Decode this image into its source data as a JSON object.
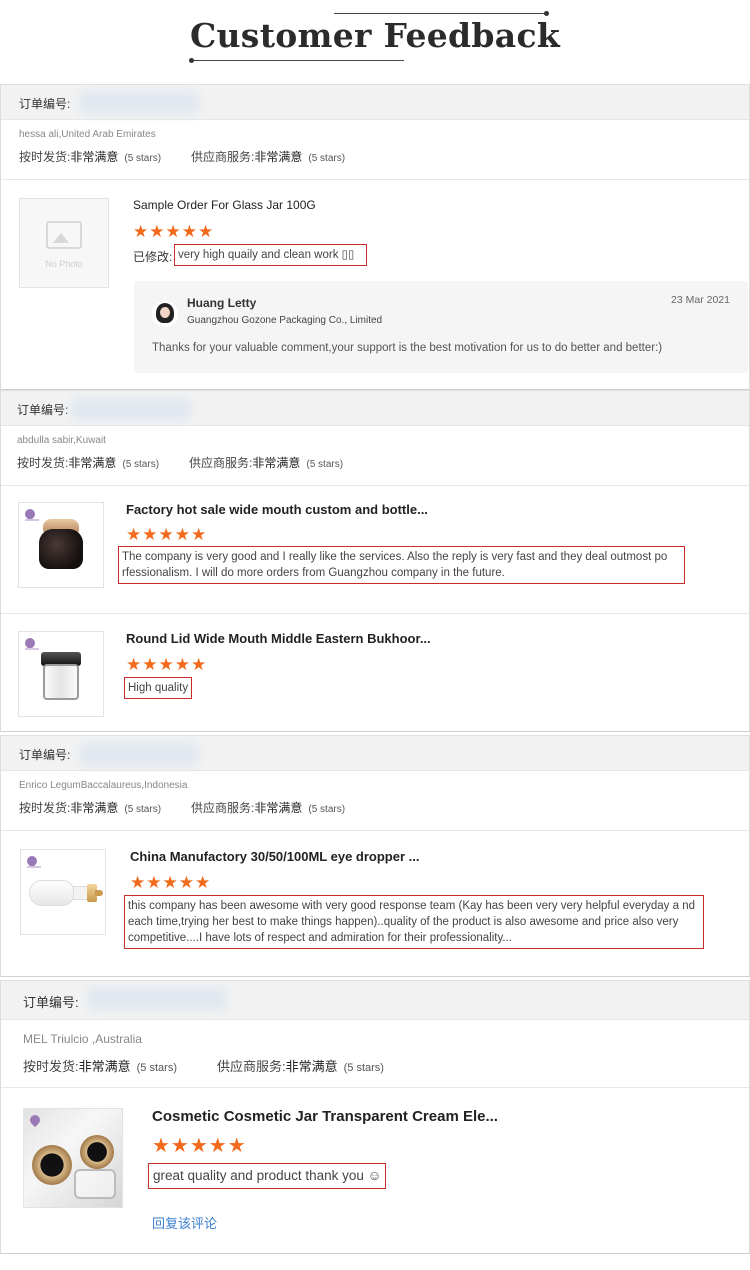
{
  "header": {
    "title": "Customer Feedback"
  },
  "labels": {
    "order_no": "订单编号:",
    "on_time": "按时发货:",
    "supplier_service": "供应商服务:",
    "very_satisfied": "非常满意",
    "five_stars": "(5 stars)",
    "no_photo": "No Photo",
    "modified": "已修改:",
    "reply_link": "回复该评论"
  },
  "stars": "★★★★★",
  "orders": [
    {
      "buyer": "hessa ali,United Arab Emirates",
      "items": [
        {
          "title": "Sample Order For Glass Jar 100G",
          "comment": "very high quaily and clean work ▯▯",
          "reply": {
            "name": "Huang Letty",
            "company": "Guangzhou Gozone Packaging Co., Limited",
            "date": "23 Mar 2021",
            "message": "Thanks for your valuable comment,your support is the best motivation for us to do better and better:)"
          }
        }
      ]
    },
    {
      "buyer": "abdulla sabir,Kuwait",
      "items": [
        {
          "title": "Factory hot sale wide mouth custom and bottle...",
          "comment": "The company is very good and I really like the services. Also the reply is very fast and they deal outmost po rfessionalism. I will do more orders from Guangzhou company in the future."
        },
        {
          "title": "Round Lid Wide Mouth Middle Eastern Bukhoor...",
          "comment": "High quality"
        }
      ]
    },
    {
      "buyer": "Enrico LegumBaccalaureus,Indonesia",
      "items": [
        {
          "title": "China Manufactory 30/50/100ML eye dropper ...",
          "comment": "this company has been awesome with very good response team (Kay has been very very helpful everyday a nd each time,trying her best to make things happen)..quality of the product is also awesome and price also very competitive....I have lots of respect and admiration for their professionality..."
        }
      ]
    },
    {
      "buyer": "MEL Triulcio ,Australia",
      "items": [
        {
          "title": "Cosmetic Cosmetic Jar Transparent Cream Ele...",
          "comment": "great quality and product thank you ☺"
        }
      ]
    }
  ]
}
